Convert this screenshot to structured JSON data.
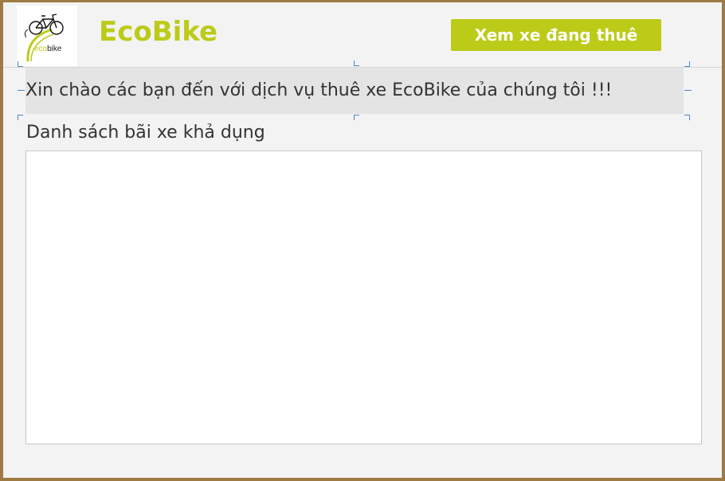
{
  "header": {
    "logo": {
      "icon": "ecobike-bicycle-logo",
      "text_prefix": "eco",
      "text_suffix": "bike",
      "accent_color": "#bccb18"
    },
    "title": "EcoBike",
    "rented_bikes_button_label": "Xem xe đang thuê"
  },
  "welcome": {
    "message": "Xin chào các bạn đến với dịch vụ thuê xe EcoBike của chúng tôi !!!"
  },
  "stations": {
    "label": "Danh sách bãi xe khả dụng",
    "items": []
  },
  "colors": {
    "brand": "#bccb18",
    "window_background": "#f3f3f3",
    "banner_background": "#e4e4e4",
    "frame": "#9e7b45"
  }
}
